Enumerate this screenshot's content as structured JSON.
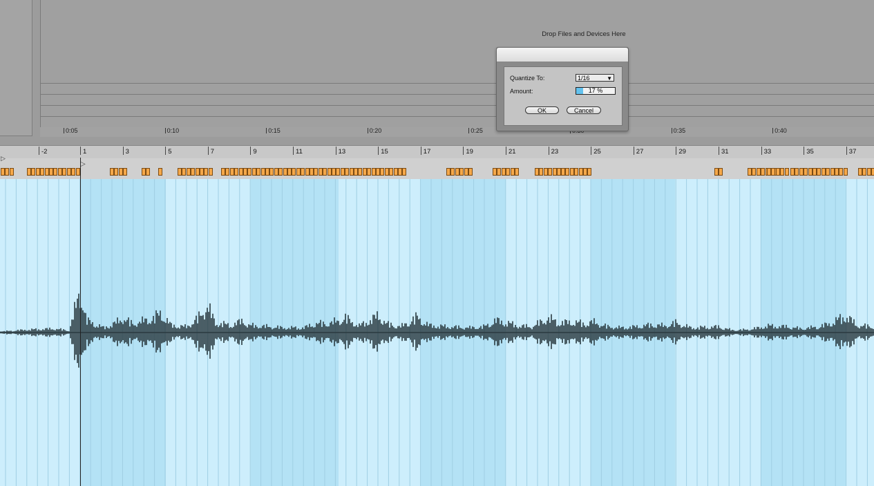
{
  "drop_zone": {
    "label": "Drop Files and Devices Here"
  },
  "time_ruler": {
    "labels": [
      "0:05",
      "0:10",
      "0:15",
      "0:20",
      "0:25",
      "0:30",
      "0:35",
      "0:40"
    ]
  },
  "bar_ruler": {
    "labels": [
      "-2",
      "1",
      "3",
      "5",
      "7",
      "9",
      "11",
      "13",
      "15",
      "17",
      "19",
      "21",
      "23",
      "25",
      "27",
      "29",
      "31",
      "33",
      "35",
      "37"
    ]
  },
  "dialog": {
    "quantize_label": "Quantize To:",
    "quantize_value": "1/16",
    "amount_label": "Amount:",
    "amount_value": "17 %",
    "amount_fraction": 0.17,
    "ok_label": "OK",
    "cancel_label": "Cancel"
  },
  "colors": {
    "waveform_bg": "#cdeefc",
    "waveform_bg_alt": "#b4e2f5",
    "waveform": "#2a3a40",
    "transient_marker": "#f5a84a"
  }
}
